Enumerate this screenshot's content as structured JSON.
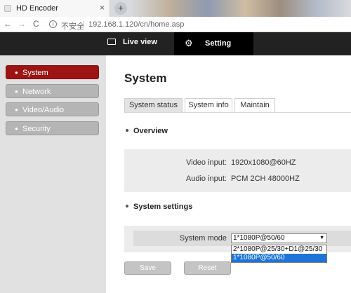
{
  "browser": {
    "tab_title": "HD Encoder",
    "tab_close": "×",
    "new_tab": "+",
    "back": "←",
    "forward": "→",
    "reload": "C",
    "info": "i",
    "security_label": "不安全",
    "separator": "|",
    "url": "192.168.1.120/cn/home.asp"
  },
  "topnav": {
    "live_view": "Live view",
    "setting": "Setting",
    "gear": "⚙"
  },
  "sidebar": {
    "items": [
      {
        "label": "System",
        "active": true
      },
      {
        "label": "Network",
        "active": false
      },
      {
        "label": "Video/Audio",
        "active": false
      },
      {
        "label": "Security",
        "active": false
      }
    ]
  },
  "page": {
    "title": "System",
    "tabs": [
      {
        "label": "System status",
        "active": true
      },
      {
        "label": "System info",
        "active": false
      },
      {
        "label": "Maintain",
        "active": false
      }
    ]
  },
  "overview": {
    "heading": "Overview",
    "video_input_label": "Video input:",
    "video_input_value": "1920x1080@60HZ",
    "audio_input_label": "Audio input:",
    "audio_input_value": "PCM 2CH 48000HZ"
  },
  "system_settings": {
    "heading": "System settings",
    "mode_label": "System mode",
    "mode_selected": "1*1080P@50/60",
    "options": [
      "2*1080P@25/30+D1@25/30",
      "1*1080P@50/60"
    ]
  },
  "buttons": {
    "save": "Save",
    "reset": "Reset"
  },
  "colors": {
    "active_side": "#9e1414",
    "topbar": "#222222",
    "dropdown_highlight": "#1e74d6"
  }
}
